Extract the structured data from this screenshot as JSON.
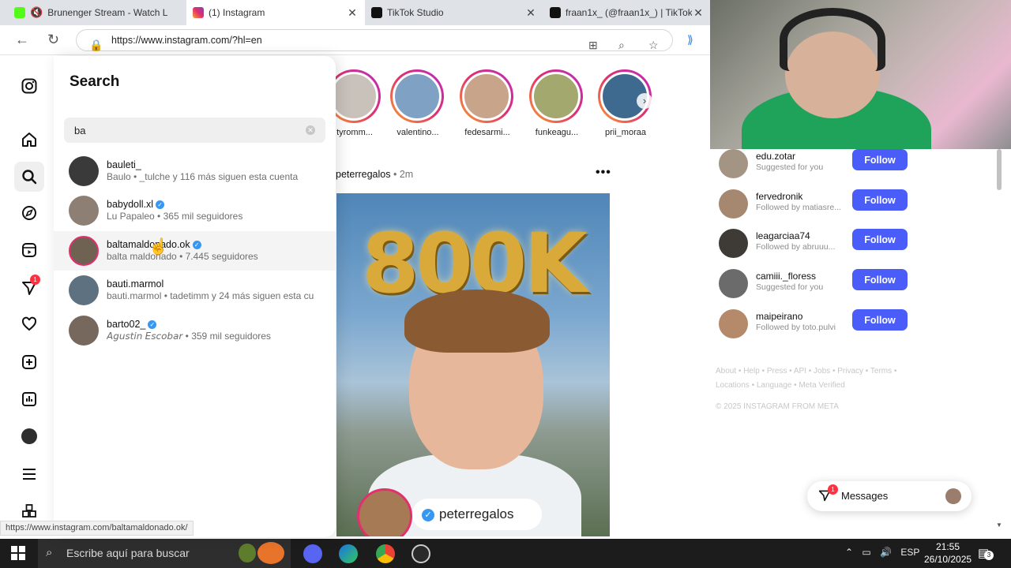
{
  "browser": {
    "tabs": [
      {
        "title": "Brunenger Stream - Watch L",
        "favicon": "kick-logo",
        "color": "#53fc18"
      },
      {
        "title": "(1) Instagram",
        "favicon": "instagram-logo",
        "color": "#e1306c"
      },
      {
        "title": "TikTok Studio",
        "favicon": "tiktok-logo",
        "color": "#111111"
      },
      {
        "title": "fraan1x_ (@fraan1x_) | TikTok",
        "favicon": "tiktok-logo",
        "color": "#111111"
      }
    ],
    "url": "https://www.instagram.com/?hl=en",
    "status_url": "https://www.instagram.com/baltamaldonado.ok/"
  },
  "search": {
    "title": "Search",
    "query": "ba",
    "results": [
      {
        "username": "bauleti_",
        "verified": false,
        "subtitle": "Baulo • _tulche y 116 más siguen esta cuenta",
        "avatar_color": "#3a3a3a"
      },
      {
        "username": "babydoll.xl",
        "verified": true,
        "subtitle": "Lu Papaleo • 365 mil seguidores",
        "avatar_color": "#8e7f74"
      },
      {
        "username": "baltamaldonado.ok",
        "verified": true,
        "subtitle": "balta maldonado • 7.445 seguidores",
        "avatar_color": "#6f6252"
      },
      {
        "username": "bauti.marmol",
        "verified": false,
        "subtitle": "bauti.marmol • tadetimm y 24 más siguen esta cu",
        "avatar_color": "#5d7180"
      },
      {
        "username": "barto02_",
        "verified": true,
        "subtitle": "𝘈𝘨𝘶𝘴𝘵𝘪𝘯 𝘌𝘴𝘤𝘰𝘣𝘢𝘳 • 359 mil seguidores",
        "avatar_color": "#77685d"
      }
    ]
  },
  "nav": {
    "items": [
      "instagram-icon",
      "home-icon",
      "search-icon",
      "explore-icon",
      "reels-icon",
      "messages-icon",
      "notifications-icon",
      "create-icon",
      "dashboard-icon",
      "profile-icon",
      "more-icon",
      "also-from-meta-icon"
    ],
    "messages_badge": "1"
  },
  "stories": [
    {
      "label": "tyromm...",
      "color": "#c9c2bb"
    },
    {
      "label": "valentino...",
      "color": "#7fa2c4"
    },
    {
      "label": "fedesarmi...",
      "color": "#c7a48a"
    },
    {
      "label": "funkeagu...",
      "color": "#a3a86e"
    },
    {
      "label": "prii_moraa",
      "color": "#3f6a8f"
    }
  ],
  "post": {
    "author": "peterregalos",
    "time": "2m",
    "big_text": "800K",
    "tag": "peterregalos"
  },
  "suggestions": [
    {
      "username": "edu.zotar",
      "subtitle": "Suggested for you",
      "color": "#a39484"
    },
    {
      "username": "fervedronik",
      "subtitle": "Followed by matiasre...",
      "color": "#a6876f"
    },
    {
      "username": "leagarciaa74",
      "subtitle": "Followed by abruuu...",
      "color": "#3e3a36"
    },
    {
      "username": "camiii._floress",
      "subtitle": "Suggested for you",
      "color": "#6b6b6b"
    },
    {
      "username": "maipeirano",
      "subtitle": "Followed by toto.pulvi",
      "color": "#b58a6b"
    }
  ],
  "follow_label": "Follow",
  "footer": {
    "links": "About • Help • Press • API • Jobs • Privacy • Terms • Locations • Language • Meta Verified",
    "copyright": "© 2025 INSTAGRAM FROM META"
  },
  "messages": {
    "label": "Messages",
    "badge": "1"
  },
  "taskbar": {
    "search_placeholder": "Escribe aquí para buscar",
    "language": "ESP",
    "time": "21:55",
    "date": "26/10/2025",
    "notification_count": "3"
  }
}
